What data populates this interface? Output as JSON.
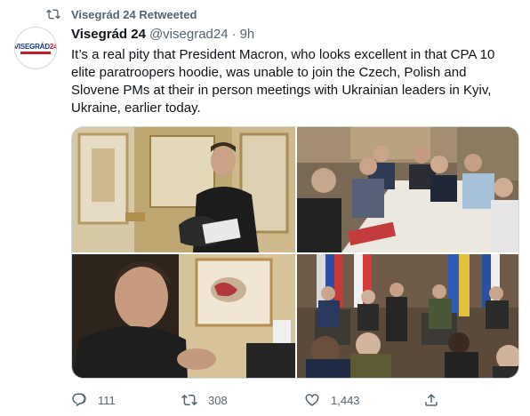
{
  "retweet_banner": {
    "icon": "retweet-icon",
    "text": "Visegrád 24 Retweeted"
  },
  "author": {
    "avatar_title": "VISEGRÁD",
    "avatar_number": "24",
    "name": "Visegrád 24",
    "handle": "@visegrad24",
    "separator": "·",
    "time": "9h"
  },
  "tweet": {
    "text": "It’s a real pity that President Macron, who looks excellent in that CPA 10 elite paratroopers hoodie, was unable to join the Czech, Polish and Slovene PMs at their in person meetings with Ukrainian leaders in Kyiv, Ukraine, earlier today."
  },
  "media": {
    "photos": [
      {
        "name": "photo-macron-standing"
      },
      {
        "name": "photo-pms-meeting-table"
      },
      {
        "name": "photo-macron-at-desk"
      },
      {
        "name": "photo-press-conference-flags"
      }
    ]
  },
  "actions": {
    "reply": {
      "icon": "reply-icon",
      "count": "111"
    },
    "retweet": {
      "icon": "retweet-icon",
      "count": "308"
    },
    "like": {
      "icon": "heart-icon",
      "count": "1,443"
    },
    "share": {
      "icon": "share-icon"
    }
  },
  "colors": {
    "secondary_text": "#536471",
    "primary_text": "#0f1419",
    "border": "#cfd9de"
  }
}
